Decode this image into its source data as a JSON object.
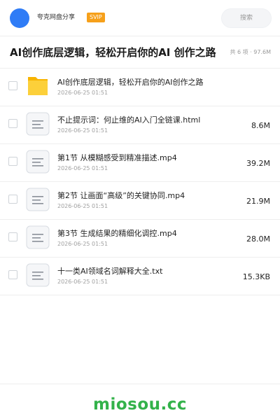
{
  "header": {
    "share_name": "夸克网盘分享",
    "badge": "SVIP",
    "search_placeholder": "搜索"
  },
  "title_row": {
    "title": "AI创作底层逻辑，轻松开启你的AI 创作之路",
    "meta": "共 6 项 · 97.6M"
  },
  "files": [
    {
      "name": "AI创作底层逻辑，轻松开启你的AI创作之路",
      "date": "2026-06-25 01:51",
      "size": "",
      "type": "folder",
      "icon": "folder-icon"
    },
    {
      "name": "不止提示词：何止维的AI入门全链课.html",
      "date": "2026-06-25 01:51",
      "size": "8.6M",
      "type": "file",
      "icon": "document-icon"
    },
    {
      "name": "第1节 从模糊感受到精准描述.mp4",
      "date": "2026-06-25 01:51",
      "size": "39.2M",
      "type": "file",
      "icon": "document-icon"
    },
    {
      "name": "第2节 让画面“高级”的关键协同.mp4",
      "date": "2026-06-25 01:51",
      "size": "21.9M",
      "type": "file",
      "icon": "document-icon"
    },
    {
      "name": "第3节 生成结果的精细化调控.mp4",
      "date": "2026-06-25 01:51",
      "size": "28.0M",
      "type": "file",
      "icon": "document-icon"
    },
    {
      "name": "十一类AI领域名词解释大全.txt",
      "date": "2026-06-25 01:51",
      "size": "15.3KB",
      "type": "file",
      "icon": "document-icon"
    }
  ],
  "footer": {
    "brand": "miosou.cc"
  },
  "colors": {
    "avatar": "#2f7cf6",
    "badge": "#f6a01a",
    "folder": "#fbc02d",
    "brand": "#33b24a"
  }
}
